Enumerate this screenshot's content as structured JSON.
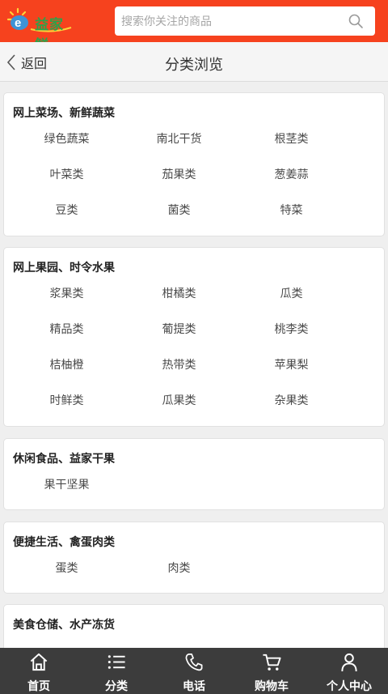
{
  "header": {
    "logo_text": "益家鲜",
    "search_placeholder": "搜索你关注的商品"
  },
  "nav": {
    "back_label": "返回",
    "title": "分类浏览"
  },
  "sections": [
    {
      "title": "网上菜场、新鲜蔬菜",
      "items": [
        "绿色蔬菜",
        "南北干货",
        "根茎类",
        "叶菜类",
        "茄果类",
        "葱姜蒜",
        "豆类",
        "菌类",
        "特菜"
      ]
    },
    {
      "title": "网上果园、时令水果",
      "items": [
        "浆果类",
        "柑橘类",
        "瓜类",
        "精品类",
        "葡提类",
        "桃李类",
        "桔柚橙",
        "热带类",
        "苹果梨",
        "时鲜类",
        "瓜果类",
        "杂果类"
      ]
    },
    {
      "title": "休闲食品、益家干果",
      "items": [
        "果干坚果"
      ]
    },
    {
      "title": "便捷生活、禽蛋肉类",
      "items": [
        "蛋类",
        "肉类"
      ]
    },
    {
      "title": "美食仓储、水产冻货",
      "items": []
    }
  ],
  "tabbar": {
    "home": "首页",
    "category": "分类",
    "phone": "电话",
    "cart": "购物车",
    "profile": "个人中心"
  },
  "colors": {
    "header_bg": "#f6421e",
    "tabbar_bg": "#3c3c3c",
    "logo_green": "#2da24a"
  }
}
